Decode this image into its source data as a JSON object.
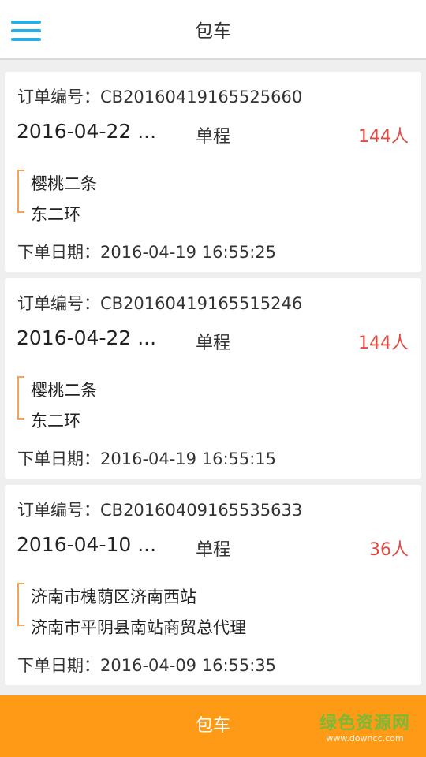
{
  "header": {
    "title": "包车",
    "menu_icon": "hamburger-menu-icon"
  },
  "orders": [
    {
      "order_no": "订单编号：CB20160419165525660",
      "date": "2016-04-22 ...",
      "trip_type": "单程",
      "people": "144人",
      "from": "樱桃二条",
      "to": "东二环",
      "created": "下单日期：2016-04-19 16:55:25"
    },
    {
      "order_no": "订单编号：CB20160419165515246",
      "date": "2016-04-22 ...",
      "trip_type": "单程",
      "people": "144人",
      "from": "樱桃二条",
      "to": "东二环",
      "created": "下单日期：2016-04-19 16:55:15"
    },
    {
      "order_no": "订单编号：CB20160409165535633",
      "date": "2016-04-10 ...",
      "trip_type": "单程",
      "people": "36人",
      "from": "济南市槐荫区济南西站",
      "to": "济南市平阴县南站商贸总代理",
      "created": "下单日期：2016-04-09 16:55:35"
    }
  ],
  "bottom_bar": {
    "label": "包车"
  },
  "watermark": {
    "cn": "绿色资源网",
    "en": "www.downcc.com"
  },
  "colors": {
    "accent": "#29aee3",
    "bottom_bar": "#ff9a16",
    "people": "#e14a43",
    "route_line": "#f4a25a"
  }
}
